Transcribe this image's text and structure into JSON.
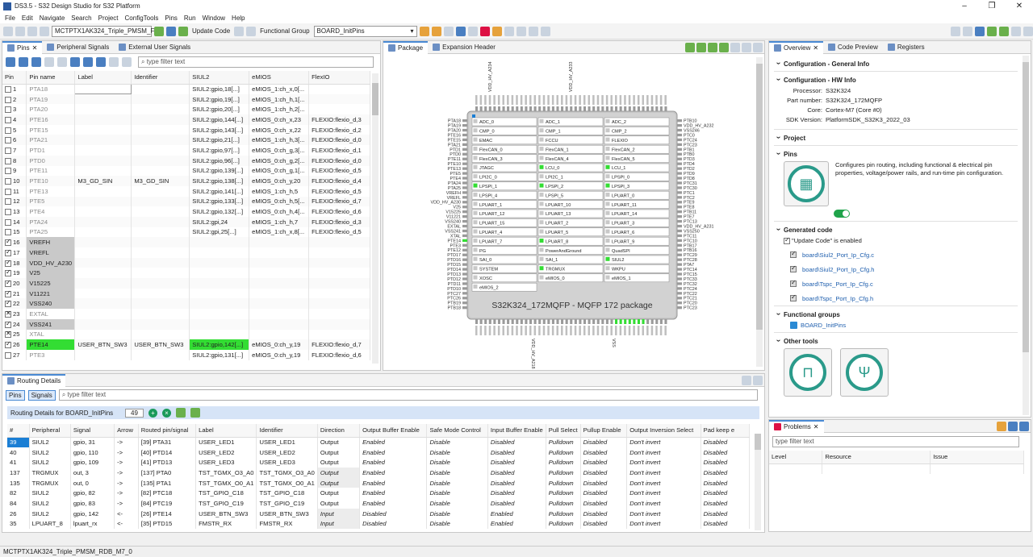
{
  "window": {
    "title": "DS3.5 - S32 Design Studio for S32 Platform"
  },
  "menu": [
    "File",
    "Edit",
    "Navigate",
    "Search",
    "Project",
    "ConfigTools",
    "Pins",
    "Run",
    "Window",
    "Help"
  ],
  "toolbar": {
    "project": "MCTPTX1AK324_Triple_PMSM_F",
    "update_code": "Update Code",
    "functional_group_label": "Functional Group",
    "functional_group": "BOARD_InitPins"
  },
  "pins_panel": {
    "tabs": [
      "Pins",
      "Peripheral Signals",
      "External User Signals"
    ],
    "filter_placeholder": "type filter text",
    "columns": [
      "Pin",
      "Pin name",
      "Label",
      "Identifier",
      "SIUL2",
      "eMIOS",
      "FlexIO"
    ],
    "rows": [
      {
        "pin": "1",
        "name": "PTA18",
        "label": "",
        "id": "",
        "siul": "SIUL2:gpio,18[...]",
        "emios": "eMIOS_1:ch_x,0[...",
        "flexio": "",
        "state": "off"
      },
      {
        "pin": "2",
        "name": "PTA19",
        "label": "",
        "id": "",
        "siul": "SIUL2:gpio,19[...]",
        "emios": "eMIOS_1:ch_h,1[...",
        "flexio": "",
        "state": "off"
      },
      {
        "pin": "3",
        "name": "PTA20",
        "label": "",
        "id": "",
        "siul": "SIUL2:gpio,20[...]",
        "emios": "eMIOS_1:ch_h,2[...",
        "flexio": "",
        "state": "off"
      },
      {
        "pin": "4",
        "name": "PTE16",
        "label": "",
        "id": "",
        "siul": "SIUL2:gpio,144[...]",
        "emios": "eMIOS_0:ch_x,23",
        "flexio": "FLEXIO:flexio_d,3",
        "state": "off"
      },
      {
        "pin": "5",
        "name": "PTE15",
        "label": "",
        "id": "",
        "siul": "SIUL2:gpio,143[...]",
        "emios": "eMIOS_0:ch_x,22",
        "flexio": "FLEXIO:flexio_d,2",
        "state": "off"
      },
      {
        "pin": "6",
        "name": "PTA21",
        "label": "",
        "id": "",
        "siul": "SIUL2:gpio,21[...]",
        "emios": "eMIOS_1:ch_h,3[...",
        "flexio": "FLEXIO:flexio_d,0",
        "state": "off"
      },
      {
        "pin": "7",
        "name": "PTD1",
        "label": "",
        "id": "",
        "siul": "SIUL2:gpio,97[...]",
        "emios": "eMIOS_0:ch_g,3[...",
        "flexio": "FLEXIO:flexio_d,1",
        "state": "off"
      },
      {
        "pin": "8",
        "name": "PTD0",
        "label": "",
        "id": "",
        "siul": "SIUL2:gpio,96[...]",
        "emios": "eMIOS_0:ch_g,2[...",
        "flexio": "FLEXIO:flexio_d,0",
        "state": "off"
      },
      {
        "pin": "9",
        "name": "PTE11",
        "label": "",
        "id": "",
        "siul": "SIUL2:gpio,139[...]",
        "emios": "eMIOS_0:ch_g,1[...",
        "flexio": "FLEXIO:flexio_d,5",
        "state": "off"
      },
      {
        "pin": "10",
        "name": "PTE10",
        "label": "M3_GD_SIN",
        "id": "M3_GD_SIN",
        "siul": "SIUL2:gpio,138[...]",
        "emios": "eMIOS_0:ch_y,20",
        "flexio": "FLEXIO:flexio_d,4",
        "state": "off"
      },
      {
        "pin": "11",
        "name": "PTE13",
        "label": "",
        "id": "",
        "siul": "SIUL2:gpio,141[...]",
        "emios": "eMIOS_1:ch_h,5",
        "flexio": "FLEXIO:flexio_d,5",
        "state": "off"
      },
      {
        "pin": "12",
        "name": "PTE5",
        "label": "",
        "id": "",
        "siul": "SIUL2:gpio,133[...]",
        "emios": "eMIOS_0:ch_h,5[...",
        "flexio": "FLEXIO:flexio_d,7",
        "state": "off"
      },
      {
        "pin": "13",
        "name": "PTE4",
        "label": "",
        "id": "",
        "siul": "SIUL2:gpio,132[...]",
        "emios": "eMIOS_0:ch_h,4[...",
        "flexio": "FLEXIO:flexio_d,6",
        "state": "off"
      },
      {
        "pin": "14",
        "name": "PTA24",
        "label": "",
        "id": "",
        "siul": "SIUL2:gpi,24",
        "emios": "eMIOS_1:ch_h,7",
        "flexio": "FLEXIO:flexio_d,3",
        "state": "off"
      },
      {
        "pin": "15",
        "name": "PTA25",
        "label": "",
        "id": "",
        "siul": "SIUL2:gpi,25[...]",
        "emios": "eMIOS_1:ch_x,8[...",
        "flexio": "FLEXIO:flexio_d,5",
        "state": "off"
      },
      {
        "pin": "16",
        "name": "VREFH",
        "label": "",
        "id": "",
        "siul": "",
        "emios": "",
        "flexio": "",
        "state": "power"
      },
      {
        "pin": "17",
        "name": "VREFL",
        "label": "",
        "id": "",
        "siul": "",
        "emios": "",
        "flexio": "",
        "state": "power"
      },
      {
        "pin": "18",
        "name": "VDD_HV_A230",
        "label": "",
        "id": "",
        "siul": "",
        "emios": "",
        "flexio": "",
        "state": "power"
      },
      {
        "pin": "19",
        "name": "V25",
        "label": "",
        "id": "",
        "siul": "",
        "emios": "",
        "flexio": "",
        "state": "power"
      },
      {
        "pin": "20",
        "name": "V15225",
        "label": "",
        "id": "",
        "siul": "",
        "emios": "",
        "flexio": "",
        "state": "power"
      },
      {
        "pin": "21",
        "name": "V11221",
        "label": "",
        "id": "",
        "siul": "",
        "emios": "",
        "flexio": "",
        "state": "power"
      },
      {
        "pin": "22",
        "name": "VSS240",
        "label": "",
        "id": "",
        "siul": "",
        "emios": "",
        "flexio": "",
        "state": "power"
      },
      {
        "pin": "23",
        "name": "EXTAL",
        "label": "",
        "id": "",
        "siul": "",
        "emios": "",
        "flexio": "",
        "state": "x"
      },
      {
        "pin": "24",
        "name": "VSS241",
        "label": "",
        "id": "",
        "siul": "",
        "emios": "",
        "flexio": "",
        "state": "power"
      },
      {
        "pin": "25",
        "name": "XTAL",
        "label": "",
        "id": "",
        "siul": "",
        "emios": "",
        "flexio": "",
        "state": "x"
      },
      {
        "pin": "26",
        "name": "PTE14",
        "label": "USER_BTN_SW3",
        "id": "USER_BTN_SW3",
        "siul": "SIUL2:gpio,142[...]",
        "emios": "eMIOS_0:ch_y,19",
        "flexio": "FLEXIO:flexio_d,7",
        "state": "green"
      },
      {
        "pin": "27",
        "name": "PTE3",
        "label": "",
        "id": "",
        "siul": "SIUL2:gpio,131[...]",
        "emios": "eMIOS_0:ch_y,19",
        "flexio": "FLEXIO:flexio_d,6",
        "state": "off"
      }
    ]
  },
  "package_panel": {
    "tabs": [
      "Package",
      "Expansion Header"
    ],
    "chip_label": "S32K324_172MQFP - MQFP 172 package",
    "peripherals": [
      [
        "ADC_0",
        "ADC_1",
        "ADC_2"
      ],
      [
        "CMP_0",
        "CMP_1",
        "CMP_2"
      ],
      [
        "EMAC",
        "FCCU",
        "FLEXIO"
      ],
      [
        "FlexCAN_0",
        "FlexCAN_1",
        "FlexCAN_2"
      ],
      [
        "FlexCAN_3",
        "FlexCAN_4",
        "FlexCAN_5"
      ],
      [
        "JTAGC",
        "LCU_0",
        "LCU_1"
      ],
      [
        "LPI2C_0",
        "LPI2C_1",
        "LPSPI_0"
      ],
      [
        "LPSPI_1",
        "LPSPI_2",
        "LPSPI_3"
      ],
      [
        "LPSPI_4",
        "LPSPI_5",
        "LPUART_0"
      ],
      [
        "LPUART_1",
        "LPUART_10",
        "LPUART_11"
      ],
      [
        "LPUART_12",
        "LPUART_13",
        "LPUART_14"
      ],
      [
        "LPUART_15",
        "LPUART_2",
        "LPUART_3"
      ],
      [
        "LPUART_4",
        "LPUART_5",
        "LPUART_6"
      ],
      [
        "LPUART_7",
        "LPUART_8",
        "LPUART_9"
      ],
      [
        "PG",
        "PowerAndGround",
        "QuadSPI"
      ],
      [
        "SAI_0",
        "SAI_1",
        "SIUL2"
      ],
      [
        "SYSTEM",
        "TRGMUX",
        "WKPU"
      ],
      [
        "XOSC",
        "eMIOS_0",
        "eMIOS_1"
      ],
      [
        "eMIOS_2",
        "",
        ""
      ]
    ],
    "active": [
      "LCU_0",
      "LCU_1",
      "LPSPI_1",
      "LPSPI_2",
      "LPSPI_3",
      "LPUART_8",
      "SIUL2",
      "TRGMUX"
    ],
    "left_pins": [
      "PTA18",
      "PTA19",
      "PTA20",
      "PTE16",
      "PTE15",
      "PTA21",
      "PTD1",
      "PTD0",
      "PTE11",
      "PTE10",
      "PTE13",
      "PTE5",
      "PTE4",
      "PTA24",
      "PTA25",
      "VREFH",
      "VREFL",
      "VDD_HV_A230",
      "V25",
      "V15225",
      "V11221",
      "VSS240",
      "EXTAL",
      "VSS241",
      "XTAL",
      "PTE14",
      "PTE3",
      "PTE12",
      "PTD17",
      "PTD16",
      "PTD15",
      "PTD14",
      "PTD13",
      "PTD12",
      "PTD11",
      "PTD10",
      "PTC27",
      "PTC26",
      "PTB19",
      "PTB18"
    ],
    "right_pins": [
      "PTB10",
      "VDD_HV_A232",
      "VSS246",
      "PTC0",
      "PTC24",
      "PTC23",
      "PTB1",
      "PTB0",
      "PTD3",
      "PTD4",
      "PTD2",
      "PTD9",
      "PTD8",
      "PTC31",
      "PTC30",
      "PTC1",
      "PTC2",
      "PTE9",
      "PTE8",
      "PTB11",
      "PTE7",
      "PTC13",
      "VDD_HV_A231",
      "VSS250",
      "PTC11",
      "PTC10",
      "PTB17",
      "PTB16",
      "PTC29",
      "PTC28",
      "PTA7",
      "PTC14",
      "PTC15",
      "PTC33",
      "PTC32",
      "PTC24",
      "PTC22",
      "PTC21",
      "PTC20",
      "PTC23"
    ],
    "top_labels": [
      "VDD_HV_A234",
      "VDD_HV_A233"
    ],
    "bottom_labels": [
      "VDD_HV_A218",
      "VSS"
    ]
  },
  "overview": {
    "tabs": [
      "Overview",
      "Code Preview",
      "Registers"
    ],
    "general_info": "Configuration - General Info",
    "hw_info": "Configuration - HW Info",
    "processor_label": "Processor:",
    "processor": "S32K324",
    "part_label": "Part number:",
    "part": "S32K324_172MQFP",
    "core_label": "Core:",
    "core": "Cortex-M7 (Core #0)",
    "sdk_label": "SDK Version:",
    "sdk": "PlatformSDK_S32K3_2022_03",
    "project": "Project",
    "pins": "Pins",
    "pins_desc": "Configures pin routing, including functional & electrical pin properties, voltage/power rails, and run-time pin configuration.",
    "generated_code": "Generated code",
    "update_enabled": "\"Update Code\" is enabled",
    "files": [
      "board\\Siul2_Port_Ip_Cfg.c",
      "board\\Siul2_Port_Ip_Cfg.h",
      "board\\Tspc_Port_Ip_Cfg.c",
      "board\\Tspc_Port_Ip_Cfg.h"
    ],
    "functional_groups": "Functional groups",
    "fg_item": "BOARD_InitPins",
    "other_tools": "Other tools"
  },
  "routing": {
    "tab": "Routing Details",
    "btn_pins": "Pins",
    "btn_signals": "Signals",
    "filter_placeholder": "type filter text",
    "header_title": "Routing Details for BOARD_InitPins",
    "count": "49",
    "columns": [
      "#",
      "Peripheral",
      "Signal",
      "Arrow",
      "Routed pin/signal",
      "Label",
      "Identifier",
      "Direction",
      "Output Buffer Enable",
      "Safe Mode Control",
      "Input Buffer Enable",
      "Pull Select",
      "Pullup Enable",
      "Output Inversion Select",
      "Pad keep e"
    ],
    "rows": [
      [
        "39",
        "SIUL2",
        "gpio, 31",
        "->",
        "[39] PTA31",
        "USER_LED1",
        "USER_LED1",
        "Output",
        "Enabled",
        "Disable",
        "Disabled",
        "Pulldown",
        "Disabled",
        "Don't invert",
        "Disabled"
      ],
      [
        "40",
        "SIUL2",
        "gpio, 110",
        "->",
        "[40] PTD14",
        "USER_LED2",
        "USER_LED2",
        "Output",
        "Enabled",
        "Disable",
        "Disabled",
        "Pulldown",
        "Disabled",
        "Don't invert",
        "Disabled"
      ],
      [
        "41",
        "SIUL2",
        "gpio, 109",
        "->",
        "[41] PTD13",
        "USER_LED3",
        "USER_LED3",
        "Output",
        "Enabled",
        "Disable",
        "Disabled",
        "Pulldown",
        "Disabled",
        "Don't invert",
        "Disabled"
      ],
      [
        "137",
        "TRGMUX",
        "out, 3",
        "->",
        "[137] PTA0",
        "TST_TGMX_O3_A0",
        "TST_TGMX_O3_A0",
        "Output",
        "Enabled",
        "Disable",
        "Disabled",
        "Pulldown",
        "Disabled",
        "Don't invert",
        "Disabled"
      ],
      [
        "135",
        "TRGMUX",
        "out, 0",
        "->",
        "[135] PTA1",
        "TST_TGMX_O0_A1",
        "TST_TGMX_O0_A1",
        "Output",
        "Enabled",
        "Disable",
        "Disabled",
        "Pulldown",
        "Disabled",
        "Don't invert",
        "Disabled"
      ],
      [
        "82",
        "SIUL2",
        "gpio, 82",
        "->",
        "[82] PTC18",
        "TST_GPIO_C18",
        "TST_GPIO_C18",
        "Output",
        "Enabled",
        "Disable",
        "Disabled",
        "Pulldown",
        "Disabled",
        "Don't invert",
        "Disabled"
      ],
      [
        "84",
        "SIUL2",
        "gpio, 83",
        "->",
        "[84] PTC19",
        "TST_GPIO_C19",
        "TST_GPIO_C19",
        "Output",
        "Enabled",
        "Disable",
        "Disabled",
        "Pulldown",
        "Disabled",
        "Don't invert",
        "Disabled"
      ],
      [
        "26",
        "SIUL2",
        "gpio, 142",
        "<-",
        "[26] PTE14",
        "USER_BTN_SW3",
        "USER_BTN_SW3",
        "Input",
        "Disabled",
        "Disable",
        "Enabled",
        "Pulldown",
        "Disabled",
        "Don't invert",
        "Disabled"
      ],
      [
        "35",
        "LPUART_8",
        "lpuart_rx",
        "<-",
        "[35] PTD15",
        "FMSTR_RX",
        "FMSTR_RX",
        "Input",
        "Disabled",
        "Disable",
        "Enabled",
        "Pulldown",
        "Disabled",
        "Don't invert",
        "Disabled"
      ]
    ]
  },
  "problems": {
    "tab": "Problems",
    "filter_placeholder": "type filter text",
    "columns": [
      "Level",
      "Resource",
      "Issue"
    ]
  },
  "status": {
    "text": "MCTPTX1AK324_Triple_PMSM_RDB_M7_0"
  }
}
